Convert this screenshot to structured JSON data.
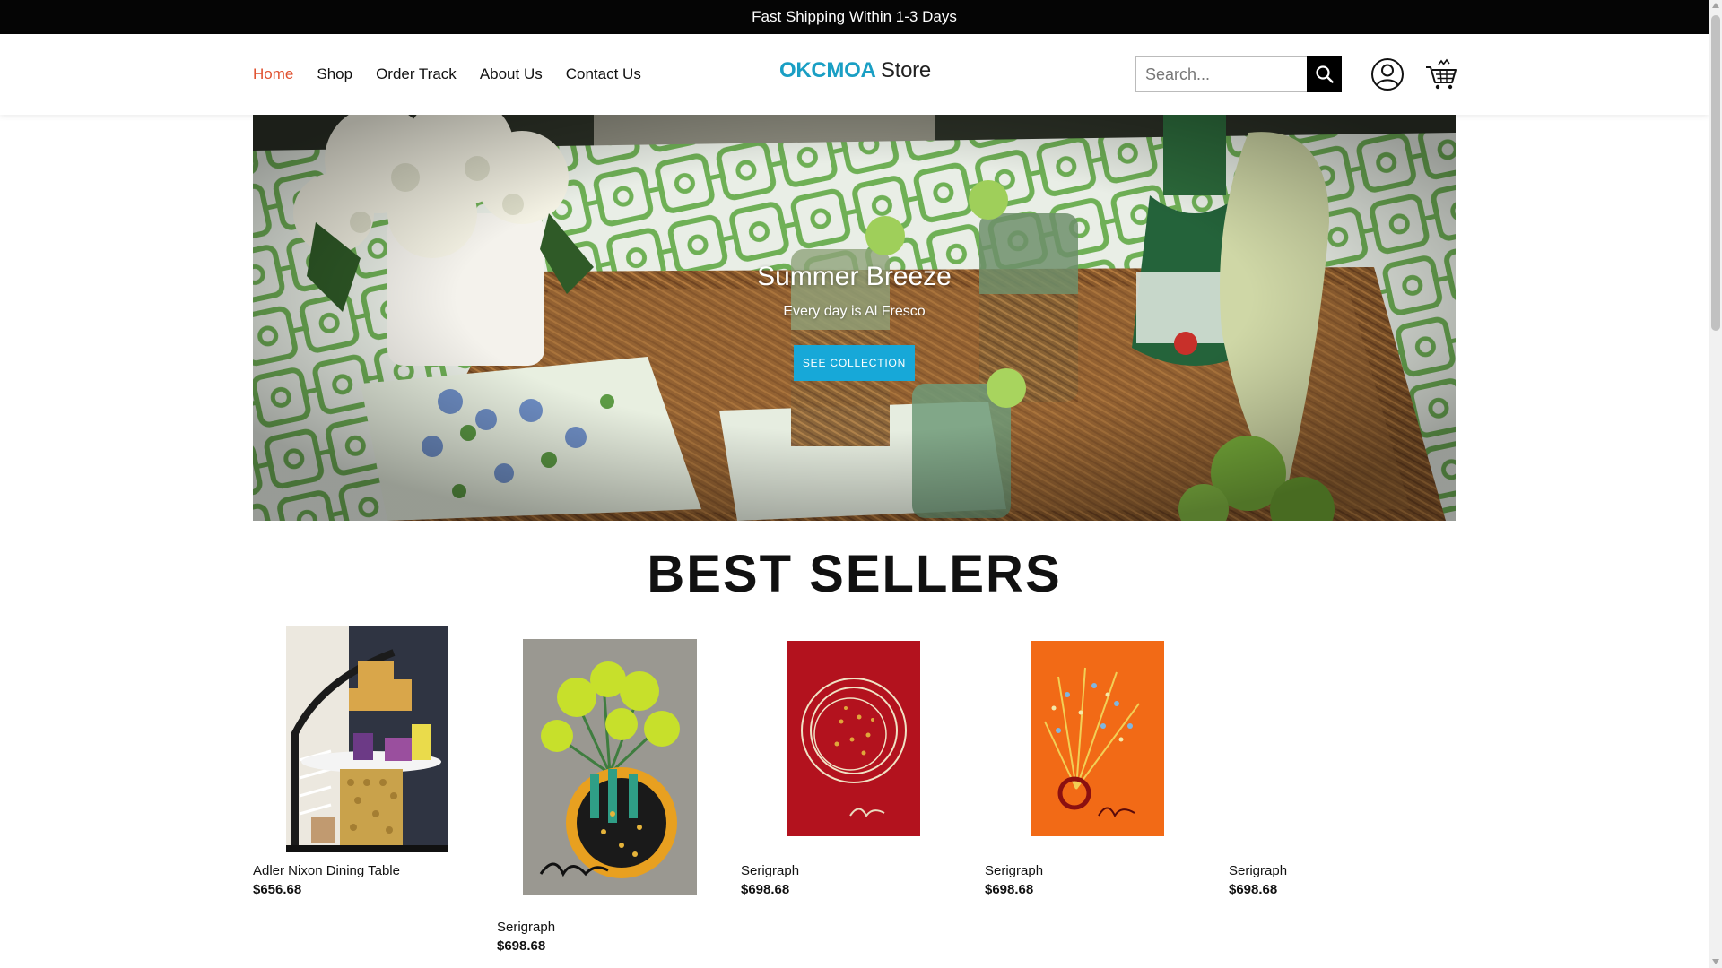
{
  "announcement": {
    "text": "Fast Shipping Within 1-3 Days"
  },
  "nav": {
    "items": [
      {
        "label": "Home",
        "active": true
      },
      {
        "label": "Shop"
      },
      {
        "label": "Order Track"
      },
      {
        "label": "About Us"
      },
      {
        "label": "Contact Us"
      }
    ]
  },
  "logo": {
    "brand": "OKCMOA",
    "suffix": "Store"
  },
  "search": {
    "placeholder": "Search..."
  },
  "hero": {
    "title": "Summer Breeze",
    "subtitle": "Every day is Al Fresco",
    "button_label": "SEE COLLECTION"
  },
  "best_sellers": {
    "title": "BEST SELLERS",
    "products": [
      {
        "name": "Adler Nixon Dining Table",
        "price": "$656.68"
      },
      {
        "name": "Serigraph",
        "price": "$698.68"
      },
      {
        "name": "Serigraph",
        "price": "$698.68"
      },
      {
        "name": "Serigraph",
        "price": "$698.68"
      },
      {
        "name": "Serigraph",
        "price": "$698.68"
      }
    ]
  },
  "colors": {
    "accent_active": "#e0512f",
    "brand": "#1a9fc4",
    "hero_button": "#17a8d8"
  }
}
